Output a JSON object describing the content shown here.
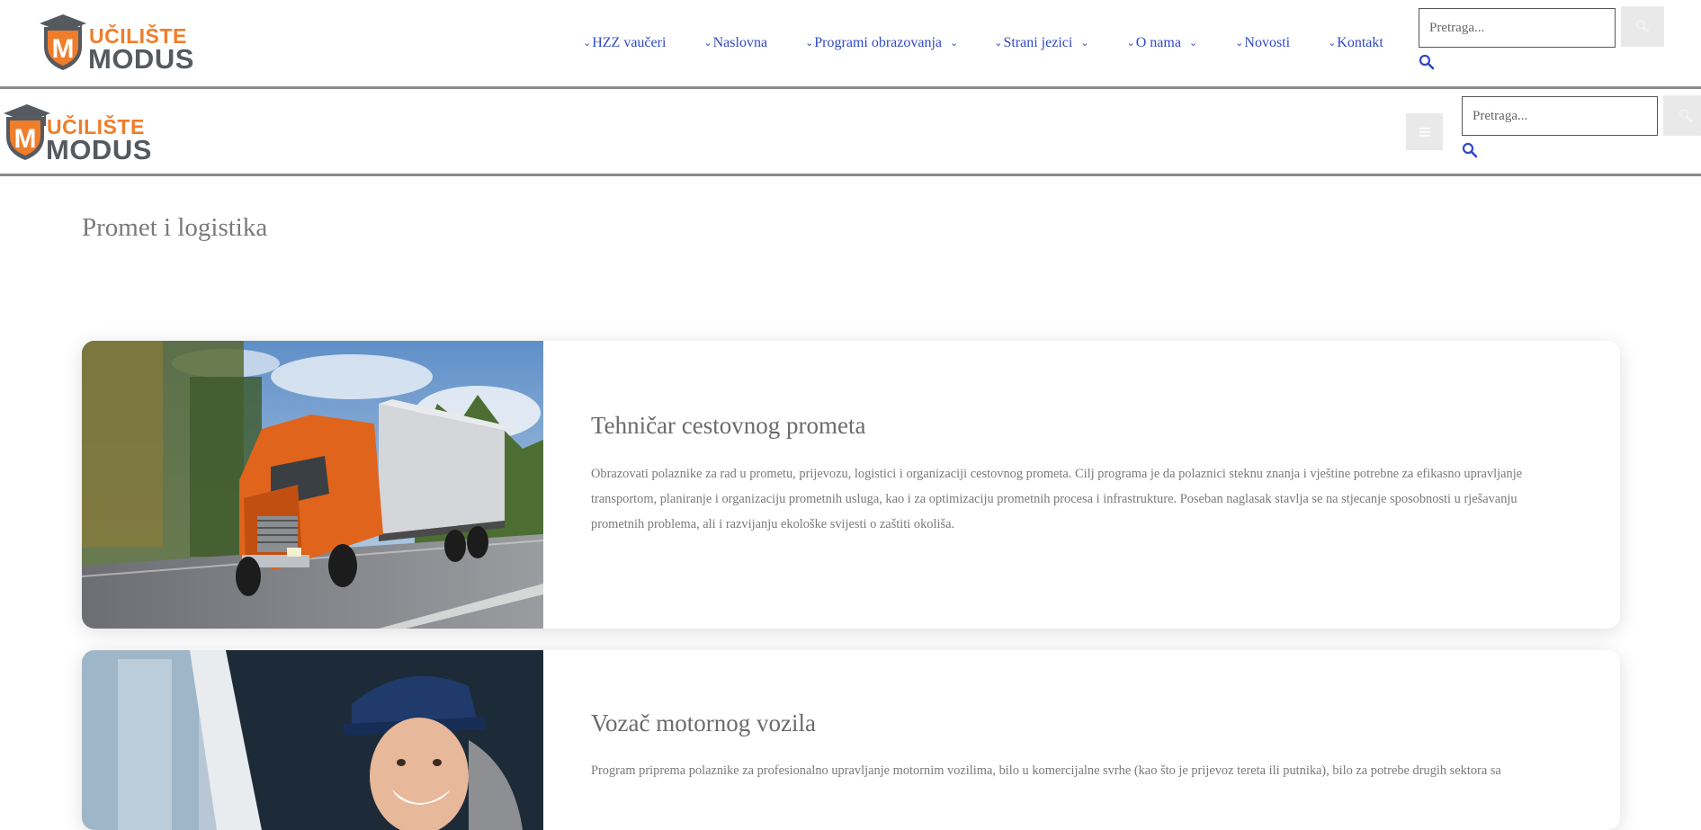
{
  "logo": {
    "line1": "UČILIŠTE",
    "line2": "MODUS",
    "mark": "M",
    "icon": "graduation-cap-shield-logo"
  },
  "colors": {
    "accent": "#f07d2a",
    "nav_link": "#2f48c7",
    "logo_gray": "#555a60"
  },
  "nav": {
    "items": [
      {
        "label": "HZZ vaučeri",
        "has_submenu": false
      },
      {
        "label": "Naslovna",
        "has_submenu": false
      },
      {
        "label": "Programi obrazovanja",
        "has_submenu": true
      },
      {
        "label": "Strani jezici",
        "has_submenu": true
      },
      {
        "label": "O nama",
        "has_submenu": true
      },
      {
        "label": "Novosti",
        "has_submenu": false
      },
      {
        "label": "Kontakt",
        "has_submenu": false
      }
    ]
  },
  "search": {
    "placeholder": "Pretraga...",
    "button_icon": "search-icon",
    "link_icon": "magnifier-icon"
  },
  "mobile_header": {
    "menu_icon": "hamburger-icon",
    "search_placeholder": "Pretraga..."
  },
  "page": {
    "title": "Promet i logistika"
  },
  "programs": [
    {
      "title": "Tehničar cestovnog prometa",
      "image": "orange-truck-on-highway",
      "description_lines": [
        "Obrazovati polaznike za rad u prometu, prijevozu, logistici i organizaciji cestovnog prometa. Cilj programa je da polaznici steknu znanja i vještine potrebne za efikasno upravljanje",
        "transportom, planiranje i organizaciju prometnih usluga, kao i za optimizaciju prometnih procesa i infrastrukture. Poseban naglasak stavlja se na stjecanje sposobnosti u rješavanju",
        "prometnih problema, ali i razvijanju ekološke svijesti o zaštiti okoliša."
      ]
    },
    {
      "title": "Vozač motornog vozila",
      "image": "smiling-driver-in-cap",
      "description_lines": [
        "Program priprema polaznike za profesionalno upravljanje motornim vozilima, bilo u komercijalne svrhe (kao što je prijevoz tereta ili putnika), bilo za potrebe drugih sektora sa"
      ]
    }
  ]
}
